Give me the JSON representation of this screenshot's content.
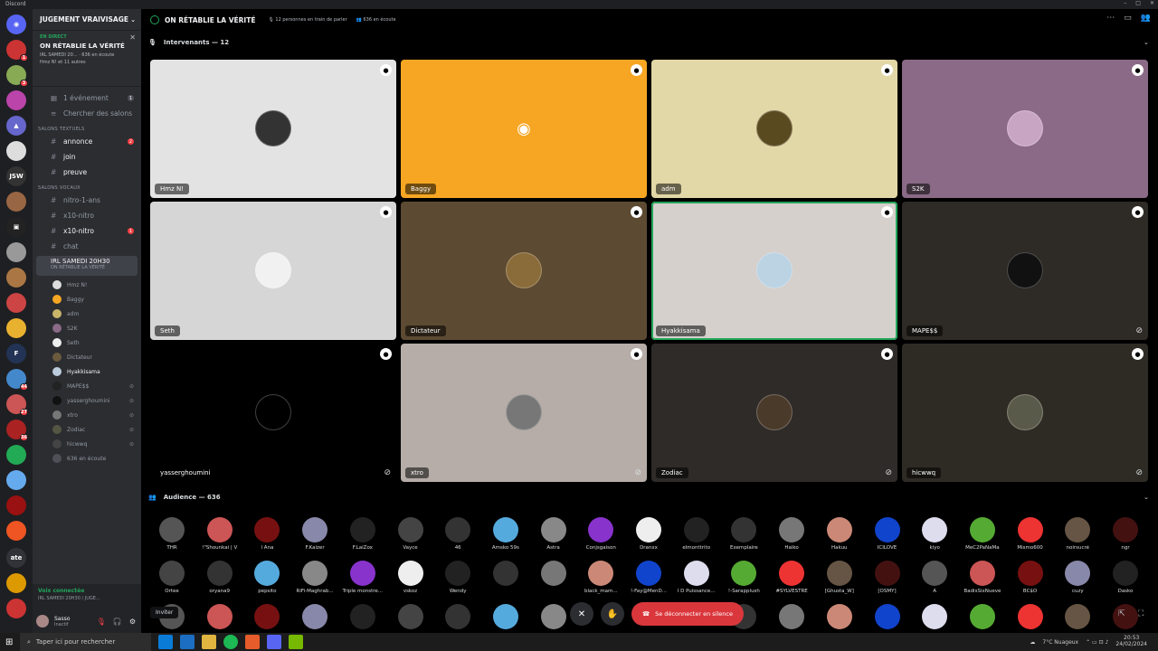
{
  "app": {
    "title": "Discord"
  },
  "server": {
    "name": "JUGEMENT VRAIVISAGE"
  },
  "live": {
    "tag": "EN DIRECT",
    "name": "ON RÉTABLIE LA VÉRITÉ",
    "sub1": "IRL SAMEDI 20... · 636 en écoute",
    "sub2": "Hmz N! et 11 autres"
  },
  "events": {
    "label": "1 événement",
    "count": "1"
  },
  "browse": {
    "label": "Chercher des salons"
  },
  "text_category": "SALONS TEXTUELS",
  "text_channels": [
    {
      "name": "annonce",
      "badge": "2"
    },
    {
      "name": "join",
      "badge": ""
    },
    {
      "name": "preuve",
      "badge": ""
    }
  ],
  "voice_category": "SALONS VOCAUX",
  "voice_channels": [
    {
      "name": "nitro-1-ans",
      "badge": ""
    },
    {
      "name": "x10-nitro",
      "badge": ""
    },
    {
      "name": "x10-nitro",
      "badge": "1"
    },
    {
      "name": "chat",
      "badge": ""
    }
  ],
  "active_voice": {
    "name": "IRL SAMEDI 20H30",
    "sub": "ON RÉTABLIE LA VÉRITÉ"
  },
  "members": [
    {
      "name": "Hmz N!",
      "color": "#ddd",
      "icon": ""
    },
    {
      "name": "Baggy",
      "color": "#f6a623",
      "icon": ""
    },
    {
      "name": "adm",
      "color": "#c9b46a",
      "icon": ""
    },
    {
      "name": "S2K",
      "color": "#8a6a86",
      "icon": ""
    },
    {
      "name": "Seth",
      "color": "#eee",
      "icon": ""
    },
    {
      "name": "Dictateur",
      "color": "#6b5a3d",
      "icon": ""
    },
    {
      "name": "Hyakkisama",
      "color": "#bcd",
      "icon": ""
    },
    {
      "name": "MAPE$$",
      "color": "#222",
      "icon": "mic-off"
    },
    {
      "name": "yasserghoumini",
      "color": "#111",
      "icon": "mic-off"
    },
    {
      "name": "xtro",
      "color": "#777",
      "icon": "mic-off"
    },
    {
      "name": "Zodiac",
      "color": "#554",
      "icon": "mic-off"
    },
    {
      "name": "hicwwq",
      "color": "#444",
      "icon": "mic-off"
    }
  ],
  "listening": {
    "label": "636 en écoute"
  },
  "voice_connected": {
    "status": "Voix connectée",
    "detail": "IRL SAMEDI 20H30 / JUGE..."
  },
  "user": {
    "name": "Sasso",
    "status": "Inactif"
  },
  "stage": {
    "title": "ON RÉTABLIE LA VÉRITÉ",
    "speakers_stat": "12 personnes en train de parler",
    "listeners_stat": "636 en écoute"
  },
  "speakers_header": "Intervenants — 12",
  "speakers": [
    {
      "name": "Hmz N!",
      "bg": "#e3e3e3",
      "av": "#333",
      "muted": false,
      "selected": false
    },
    {
      "name": "Baggy",
      "bg": "#f6a623",
      "av": "#f6a623",
      "muted": false,
      "selected": false
    },
    {
      "name": "adm",
      "bg": "#e2d7a6",
      "av": "#5a4a20",
      "muted": false,
      "selected": false
    },
    {
      "name": "S2K",
      "bg": "#8a6a86",
      "av": "#c9a5c4",
      "muted": false,
      "selected": false
    },
    {
      "name": "Seth",
      "bg": "#d6d6d6",
      "av": "#f1f1f1",
      "muted": false,
      "selected": false
    },
    {
      "name": "Dictateur",
      "bg": "#5c4a32",
      "av": "#8a6b3a",
      "muted": false,
      "selected": false
    },
    {
      "name": "Hyakkisama",
      "bg": "#d6d0cc",
      "av": "#bcd3e3",
      "muted": false,
      "selected": true
    },
    {
      "name": "MAPE$$",
      "bg": "#2e2a25",
      "av": "#111",
      "muted": true,
      "selected": false
    },
    {
      "name": "yasserghoumini",
      "bg": "#000",
      "av": "#000",
      "muted": true,
      "selected": false
    },
    {
      "name": "xtro",
      "bg": "#b6ada8",
      "av": "#777",
      "muted": true,
      "selected": false
    },
    {
      "name": "Zodiac",
      "bg": "#2e2b29",
      "av": "#4a3a2a",
      "muted": true,
      "selected": false
    },
    {
      "name": "hicwwq",
      "bg": "#2e2b25",
      "av": "#5a5a4a",
      "muted": true,
      "selected": false
    }
  ],
  "audience_header": "Audience — 636",
  "audience_row1": [
    "THR",
    "!\"Shounkai | V",
    "l Ana",
    "F.Kaizer",
    "F.LaiZox",
    "Vayce",
    "46",
    "Amsko 59s",
    "Astra",
    "Conjsgaison",
    "Dranxx",
    "elmonttrito",
    "Exemplaire",
    "Haiko",
    "Hakuu",
    "ICILOVE",
    "kiyo",
    "MeC2PaNaMa",
    "Mismo600",
    "noirsucré",
    "ngr"
  ],
  "audience_row2": [
    "Ortee",
    "oryana9",
    "pepsito",
    "RiFi-Maghrab...",
    "Triple monstre...",
    "vskoz",
    "Wendy",
    "",
    "",
    "black_mam...",
    "!-Fay@MenD...",
    "l D Puissance...",
    "!-Sarapplush",
    "#SYLVESTRE",
    "[Ghusta_W]",
    "[OSMY]",
    "A",
    "BadisSixNueve",
    "BC$O",
    "cuzy",
    "Dasko"
  ],
  "controls": {
    "invite_tip": "Inviter",
    "disconnect": "Se déconnecter en silence"
  },
  "taskbar": {
    "search": "Taper ici pour rechercher",
    "weather": "7°C Nuageux",
    "time": "20:53",
    "date": "24/02/2024"
  }
}
